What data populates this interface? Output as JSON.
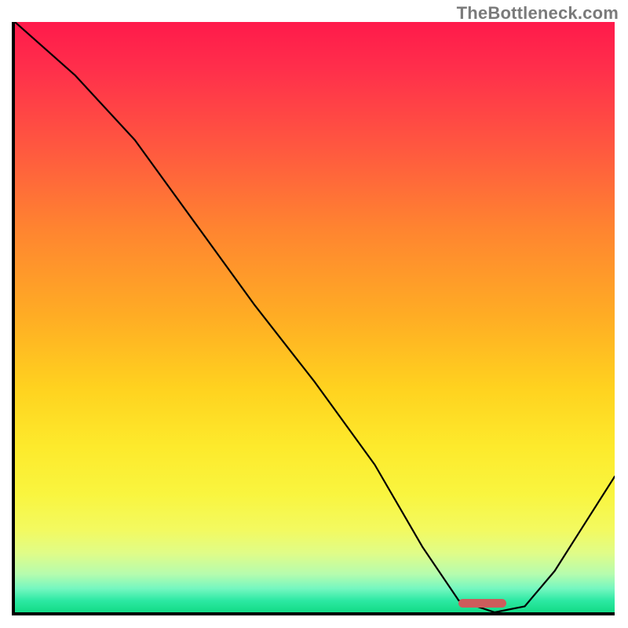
{
  "watermark": "TheBottleneck.com",
  "chart_data": {
    "type": "line",
    "title": "",
    "xlabel": "",
    "ylabel": "",
    "xlim": [
      0,
      100
    ],
    "ylim": [
      0,
      100
    ],
    "series": [
      {
        "name": "bottleneck-curve",
        "x": [
          0,
          10,
          20,
          30,
          40,
          50,
          60,
          68,
          74,
          80,
          85,
          90,
          95,
          100
        ],
        "values": [
          100,
          91,
          80,
          66,
          52,
          39,
          25,
          11,
          2,
          0,
          1,
          7,
          15,
          23
        ]
      }
    ],
    "marker": {
      "name": "optimal-range",
      "x_start": 74,
      "x_end": 82,
      "y": 0.8,
      "color": "#cd5c5c",
      "height_pct": 1.4
    },
    "background_gradient_stops": [
      {
        "pct": 0,
        "color": "#ff1a4b"
      },
      {
        "pct": 50,
        "color": "#ffad24"
      },
      {
        "pct": 80,
        "color": "#f9f53f"
      },
      {
        "pct": 96,
        "color": "#74f7c0"
      },
      {
        "pct": 100,
        "color": "#13db86"
      }
    ]
  }
}
